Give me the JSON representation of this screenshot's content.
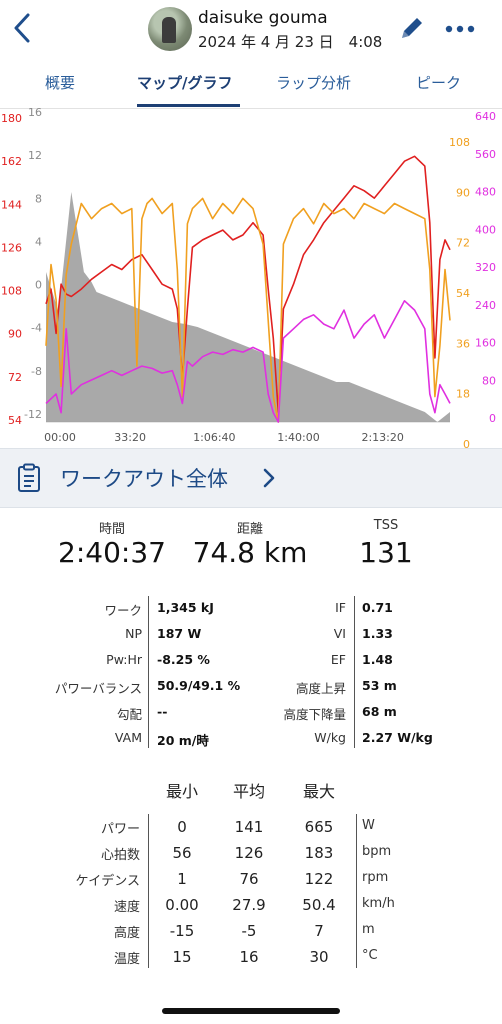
{
  "header": {
    "user_name": "daisuke gouma",
    "date_time": "2024 年 4 月 23 日　4:08"
  },
  "tabs": [
    {
      "label": "概要",
      "active": false
    },
    {
      "label": "マップ/グラフ",
      "active": true
    },
    {
      "label": "ラップ分析",
      "active": false
    },
    {
      "label": "ピーク",
      "active": false
    }
  ],
  "chart_data": {
    "type": "line",
    "x_ticks": [
      "00:00",
      "33:20",
      "1:06:40",
      "1:40:00",
      "2:13:20"
    ],
    "axes": {
      "heart_rate": {
        "color": "#e02020",
        "ticks": [
          "180",
          "162",
          "144",
          "126",
          "108",
          "90",
          "72",
          "54"
        ],
        "range": [
          54,
          180
        ]
      },
      "elevation": {
        "color": "#8a8a8a",
        "ticks": [
          "16",
          "12",
          "8",
          "4",
          "0",
          "-4",
          "-8",
          "-12"
        ],
        "range": [
          -15,
          16
        ]
      },
      "cadence": {
        "color": "#f0a020",
        "ticks": [
          "108",
          "90",
          "72",
          "54",
          "36",
          "18",
          "0"
        ],
        "range": [
          0,
          122
        ]
      },
      "power": {
        "color": "#e030e0",
        "ticks": [
          "640",
          "560",
          "480",
          "400",
          "320",
          "240",
          "160",
          "80",
          "0"
        ],
        "range": [
          0,
          665
        ]
      }
    },
    "series": [
      {
        "key": "elevation",
        "type": "area",
        "x": [
          0,
          5,
          10,
          15,
          18,
          20,
          25,
          30,
          35,
          40,
          45,
          50,
          55,
          60,
          65,
          70,
          75,
          80,
          85,
          90,
          95,
          100,
          105,
          110,
          115,
          120,
          125,
          130,
          135,
          140,
          145,
          150,
          155,
          160
        ],
        "values": [
          0,
          -4,
          8,
          0,
          -1,
          -2,
          -2.5,
          -3,
          -3.5,
          -4,
          -4.5,
          -5,
          -5.2,
          -5.5,
          -6,
          -6.5,
          -7,
          -7.5,
          -8,
          -8.5,
          -9,
          -9.5,
          -10,
          -10.5,
          -11,
          -11,
          -11.5,
          -12,
          -12.5,
          -13,
          -13.5,
          -14,
          -15,
          -14
        ]
      },
      {
        "key": "heart_rate",
        "type": "line",
        "x": [
          0,
          2,
          4,
          6,
          8,
          10,
          14,
          18,
          22,
          26,
          30,
          34,
          38,
          42,
          46,
          50,
          52,
          54,
          56,
          58,
          62,
          66,
          70,
          74,
          78,
          82,
          86,
          88,
          90,
          92,
          94,
          98,
          102,
          106,
          110,
          114,
          118,
          122,
          126,
          130,
          134,
          138,
          142,
          146,
          150,
          152,
          154,
          156,
          158,
          160
        ],
        "values": [
          102,
          108,
          90,
          110,
          106,
          105,
          108,
          112,
          115,
          118,
          116,
          120,
          122,
          116,
          110,
          108,
          100,
          72,
          100,
          125,
          128,
          130,
          132,
          128,
          130,
          135,
          130,
          108,
          88,
          58,
          100,
          110,
          122,
          128,
          135,
          140,
          145,
          150,
          148,
          145,
          150,
          155,
          160,
          162,
          158,
          135,
          80,
          120,
          128,
          124
        ]
      },
      {
        "key": "cadence",
        "type": "line",
        "x": [
          0,
          2,
          4,
          6,
          8,
          10,
          12,
          14,
          18,
          22,
          26,
          30,
          34,
          36,
          38,
          40,
          42,
          46,
          50,
          52,
          54,
          56,
          58,
          62,
          66,
          70,
          74,
          78,
          82,
          86,
          88,
          90,
          92,
          94,
          98,
          102,
          106,
          110,
          114,
          118,
          122,
          126,
          130,
          134,
          138,
          142,
          146,
          150,
          152,
          154,
          156,
          158,
          160
        ],
        "values": [
          30,
          62,
          48,
          14,
          58,
          70,
          78,
          86,
          80,
          84,
          86,
          82,
          84,
          22,
          80,
          86,
          88,
          82,
          86,
          60,
          10,
          78,
          84,
          88,
          80,
          86,
          82,
          88,
          84,
          70,
          40,
          10,
          0,
          70,
          80,
          84,
          78,
          86,
          82,
          84,
          80,
          86,
          84,
          82,
          86,
          84,
          82,
          80,
          60,
          10,
          30,
          60,
          40
        ]
      },
      {
        "key": "power",
        "type": "line",
        "x": [
          0,
          4,
          6,
          8,
          10,
          14,
          18,
          22,
          26,
          30,
          34,
          38,
          42,
          46,
          50,
          52,
          54,
          56,
          58,
          62,
          66,
          70,
          74,
          78,
          82,
          86,
          88,
          90,
          92,
          94,
          98,
          102,
          106,
          110,
          114,
          118,
          122,
          126,
          130,
          134,
          138,
          142,
          146,
          150,
          152,
          154,
          156,
          158,
          160
        ],
        "values": [
          40,
          60,
          20,
          200,
          60,
          80,
          90,
          100,
          110,
          100,
          110,
          120,
          115,
          105,
          110,
          80,
          40,
          130,
          120,
          140,
          150,
          145,
          155,
          150,
          160,
          150,
          60,
          20,
          0,
          180,
          200,
          220,
          230,
          210,
          200,
          240,
          180,
          210,
          230,
          180,
          220,
          260,
          240,
          200,
          60,
          20,
          80,
          60,
          40
        ]
      }
    ]
  },
  "section": {
    "title": "ワークアウト全体"
  },
  "summary": [
    {
      "label": "時間",
      "value": "2:40:37"
    },
    {
      "label": "距離",
      "value": "74.8 km"
    },
    {
      "label": "TSS",
      "value": "131"
    }
  ],
  "metrics_left": [
    {
      "label": "ワーク",
      "value": "1,345 kJ"
    },
    {
      "label": "NP",
      "value": "187 W"
    },
    {
      "label": "Pw:Hr",
      "value": "-8.25 %"
    },
    {
      "label": "パワーバランス",
      "value": "50.9/49.1 %"
    },
    {
      "label": "勾配",
      "value": "--"
    },
    {
      "label": "VAM",
      "value": "20 m/時"
    }
  ],
  "metrics_right": [
    {
      "label": "IF",
      "value": "0.71"
    },
    {
      "label": "VI",
      "value": "1.33"
    },
    {
      "label": "EF",
      "value": "1.48"
    },
    {
      "label": "高度上昇",
      "value": "53 m"
    },
    {
      "label": "高度下降量",
      "value": "68 m"
    },
    {
      "label": "W/kg",
      "value": "2.27 W/kg"
    }
  ],
  "minmax": {
    "headers": {
      "min": "最小",
      "avg": "平均",
      "max": "最大"
    },
    "rows": [
      {
        "label": "パワー",
        "min": "0",
        "avg": "141",
        "max": "665",
        "unit": "W"
      },
      {
        "label": "心拍数",
        "min": "56",
        "avg": "126",
        "max": "183",
        "unit": "bpm"
      },
      {
        "label": "ケイデンス",
        "min": "1",
        "avg": "76",
        "max": "122",
        "unit": "rpm"
      },
      {
        "label": "速度",
        "min": "0.00",
        "avg": "27.9",
        "max": "50.4",
        "unit": "km/h"
      },
      {
        "label": "高度",
        "min": "-15",
        "avg": "-5",
        "max": "7",
        "unit": "m"
      },
      {
        "label": "温度",
        "min": "15",
        "avg": "16",
        "max": "30",
        "unit": "°C"
      }
    ]
  }
}
